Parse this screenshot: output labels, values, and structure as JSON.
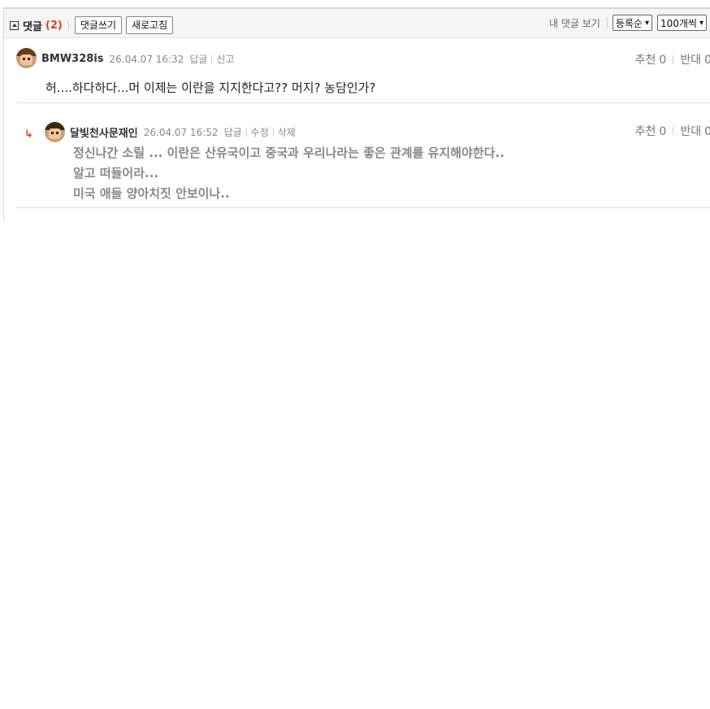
{
  "toolbar": {
    "title": "댓글",
    "count": "(2)",
    "write_label": "댓글쓰기",
    "refresh_label": "새로고침",
    "my_comments_label": "내 댓글 보기",
    "sort_selected": "등록순",
    "page_size_selected": "100개씩"
  },
  "comments": [
    {
      "author": "BMW328is",
      "date": "26.04.07 16:32",
      "actions": [
        "답글",
        "신고"
      ],
      "text": "허....하다하다...머 이제는 이란을 지지한다고?? 머지? 농담인가?",
      "upvote_label": "추천",
      "upvotes": "0",
      "downvote_label": "반대",
      "downvotes": "0"
    },
    {
      "author": "달빛천사문재인",
      "date": "26.04.07 16:52",
      "actions": [
        "답글",
        "수정",
        "삭제"
      ],
      "lines": [
        "정신나간 소릴 ... 이란은 산유국이고 중국과 우리나라는 좋은 관계를 유지해야한다..",
        "알고 떠들어라...",
        "미국 애들 양아치짓 안보이나.."
      ],
      "upvote_label": "추천",
      "upvotes": "0",
      "downvote_label": "반대",
      "downvotes": "0",
      "is_reply": true
    }
  ],
  "colors": {
    "accent": "#e0401c",
    "muted": "#888888",
    "toolbar_bg": "#f5f5f5"
  }
}
